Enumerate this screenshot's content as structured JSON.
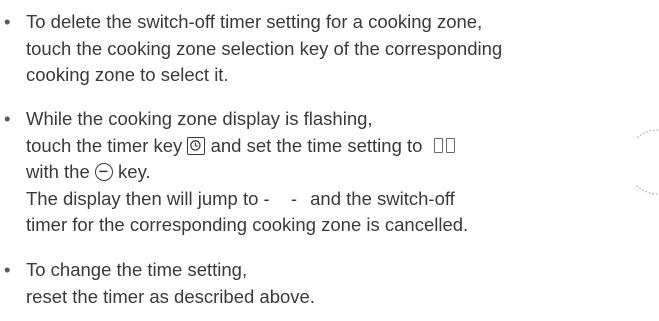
{
  "items": [
    {
      "bullet": "•",
      "lines": [
        "To delete the switch-off timer setting for a cooking zone,",
        "touch the cooking zone selection key of the corresponding",
        "cooking zone to select it."
      ]
    },
    {
      "bullet": "•",
      "line1": "While the cooking zone display is flashing,",
      "line2_a": "touch the timer key",
      "line2_b": "and set the time setting to",
      "line3_a": "with the",
      "line3_b": "key.",
      "line4_a": "The display then will jump to",
      "line4_dashes": "- -",
      "line4_b": "and the switch-off",
      "line5": "timer for the corresponding cooking zone is cancelled."
    },
    {
      "bullet": "•",
      "lines": [
        "To change the time setting,",
        "reset the timer as described above."
      ]
    }
  ],
  "icons": {
    "timer_key": "timer-key-icon",
    "minus_key": "minus-key-icon",
    "display_digits": "double-zero-display-icon"
  }
}
